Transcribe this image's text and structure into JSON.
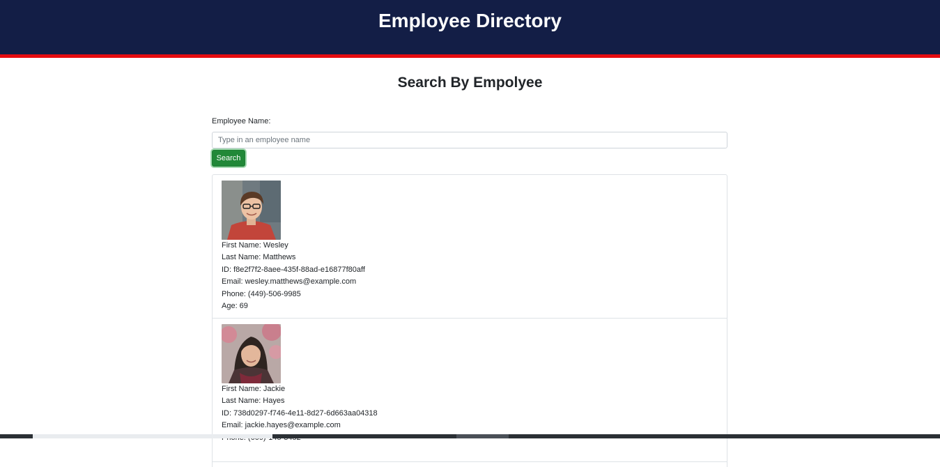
{
  "header": {
    "title": "Employee Directory"
  },
  "page": {
    "heading": "Search By Empolyee"
  },
  "search": {
    "label": "Employee Name:",
    "placeholder": "Type in an employee name",
    "value": "",
    "button_label": "Search"
  },
  "colors": {
    "header_bg": "#131e46",
    "header_accent": "#e60b0f",
    "button_bg": "#218838"
  },
  "employees": [
    {
      "first_name": "First Name: Wesley",
      "last_name": "Last Name: Matthews",
      "id": "ID: f8e2f7f2-8aee-435f-88ad-e16877f80aff",
      "email": "Email: wesley.matthews@example.com",
      "phone": "Phone: (449)-506-9985",
      "age": "Age: 69",
      "photo_icon": "employee-photo-man"
    },
    {
      "first_name": "First Name: Jackie",
      "last_name": "Last Name: Hayes",
      "id": "ID: 738d0297-f746-4e11-8d27-6d663aa04318",
      "email": "Email: jackie.hayes@example.com",
      "phone": "Phone: (609)-145-3452",
      "age": "",
      "photo_icon": "employee-photo-woman"
    }
  ]
}
